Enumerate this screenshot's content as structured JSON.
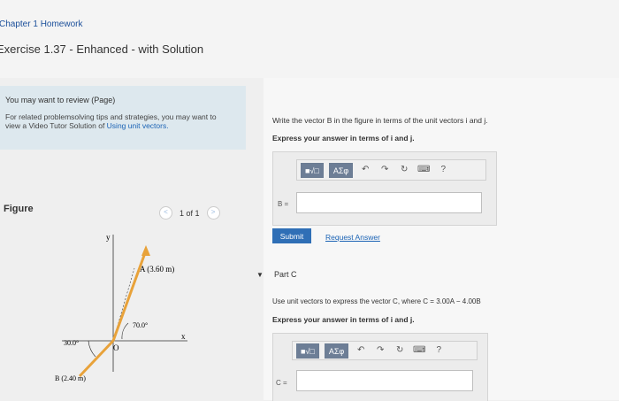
{
  "header": {
    "breadcrumb": "Chapter 1 Homework",
    "title": "Exercise 1.37 - Enhanced - with Solution"
  },
  "review": {
    "title": "You may want to review (Page)",
    "text": "For related problemsolving tips and strategies, you may want to view a Video Tutor Solution of ",
    "link": "Using unit vectors."
  },
  "figure": {
    "label": "Figure",
    "pager_text": "1 of 1",
    "prev_glyph": "<",
    "next_glyph": ">",
    "labels": {
      "y_axis": "y",
      "x_axis": "x",
      "origin": "O",
      "vector_a": "A (3.60 m)",
      "angle_a": "70.0°",
      "angle_b": "30.0°",
      "vector_b": "B (2.40 m)"
    },
    "vectors": [
      {
        "name": "A",
        "magnitude_m": 3.6,
        "angle_deg_from_x": 70.0
      },
      {
        "name": "B",
        "magnitude_m": 2.4,
        "angle_deg_from_negative_x": 30.0
      }
    ]
  },
  "part_b": {
    "question": "Write the vector B in the figure in terms of the unit vectors i and j.",
    "instruction": "Express your answer in terms of i and j.",
    "toolbar": {
      "templates_label": "■√□",
      "symbols_label": "ΑΣφ",
      "undo_glyph": "↶",
      "redo_glyph": "↷",
      "reset_glyph": "↻",
      "keyboard_glyph": "⌨",
      "help_glyph": "?"
    },
    "answer_label": "B =",
    "answer_value": "",
    "submit_label": "Submit",
    "request_label": "Request Answer"
  },
  "part_c": {
    "caret": "▼",
    "title": "Part C",
    "question": "Use unit vectors to express the vector C, where C = 3.00A − 4.00B",
    "instruction": "Express your answer in terms of i and j.",
    "toolbar": {
      "templates_label": "■√□",
      "symbols_label": "ΑΣφ",
      "undo_glyph": "↶",
      "redo_glyph": "↷",
      "reset_glyph": "↻",
      "keyboard_glyph": "⌨",
      "help_glyph": "?"
    },
    "answer_label": "C =",
    "answer_value": ""
  },
  "colors": {
    "accent": "#2f6fb6",
    "vector": "#e8a23a",
    "review_bg": "#dde8ee"
  }
}
